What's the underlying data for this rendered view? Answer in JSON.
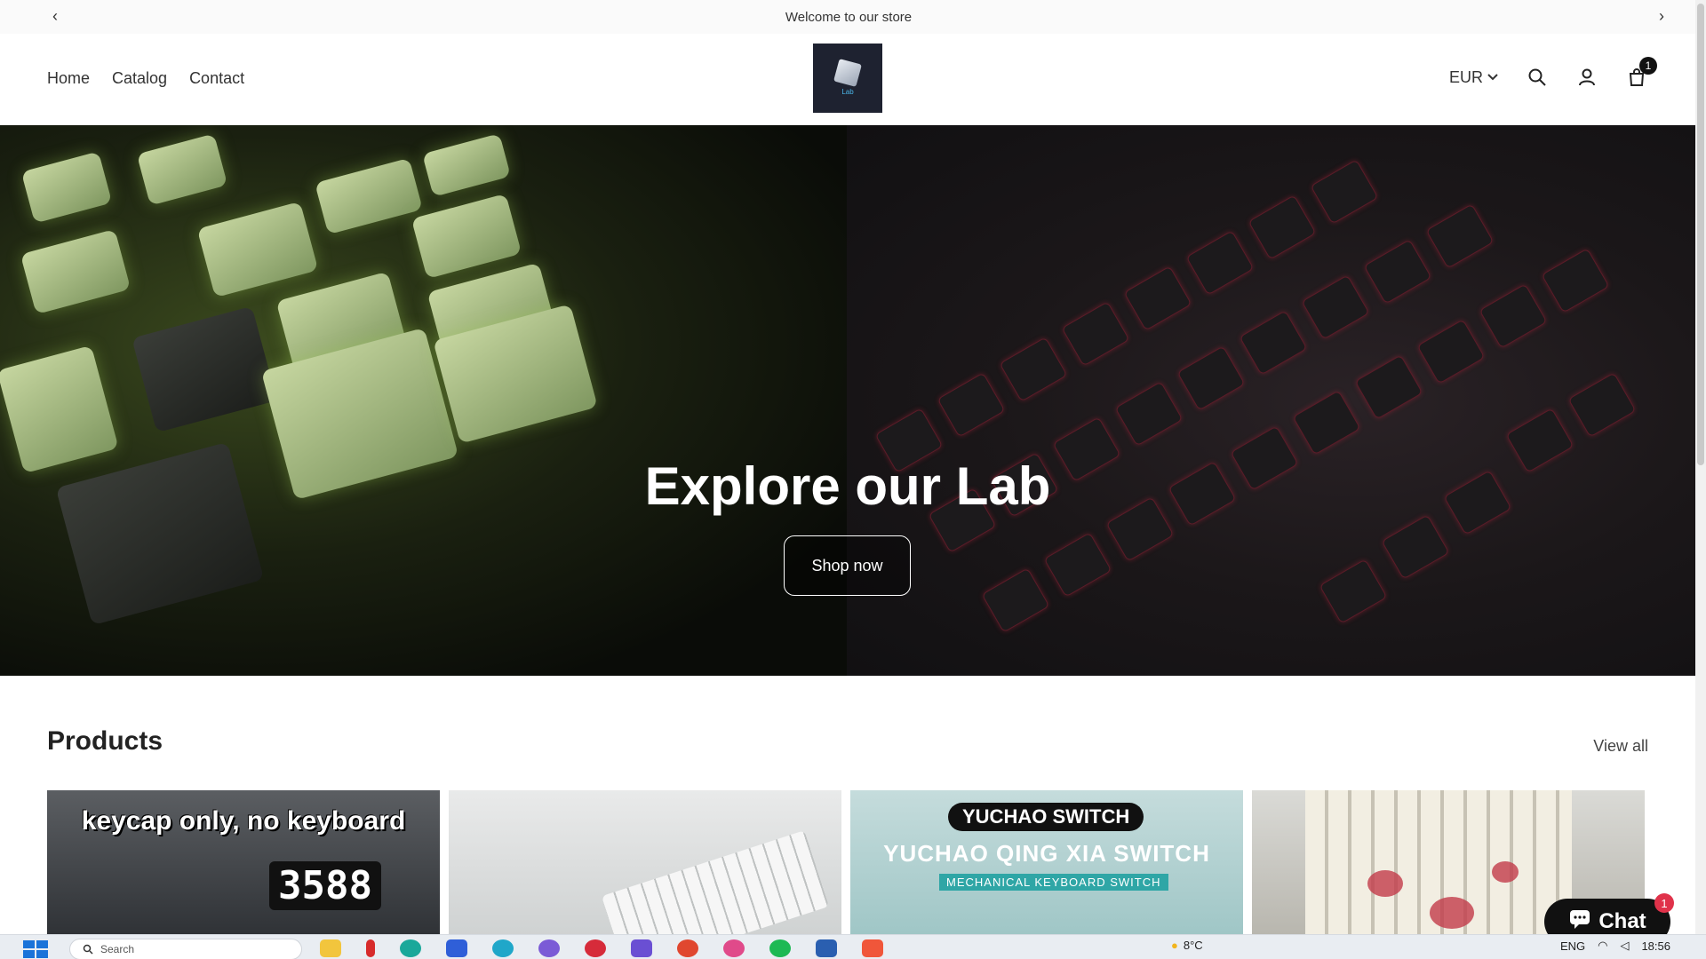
{
  "announcement": {
    "text": "Welcome to our store",
    "prev_icon": "‹",
    "next_icon": "›"
  },
  "header": {
    "nav": [
      "Home",
      "Catalog",
      "Contact"
    ],
    "logo_text": "Lab",
    "currency": "EUR",
    "currency_icon": "⌄",
    "cart_count": "1"
  },
  "hero": {
    "title": "Explore our Lab",
    "button": "Shop now"
  },
  "products": {
    "title": "Products",
    "view_all": "View all",
    "cards": [
      {
        "caption": "keycap only, no keyboard",
        "clock": "3588"
      },
      {},
      {
        "brand": "YUCHAO SWITCH",
        "subtitle": "YUCHAO QING XIA SWITCH",
        "tag": "MECHANICAL KEYBOARD SWITCH"
      },
      {}
    ]
  },
  "chat": {
    "label": "Chat",
    "badge": "1"
  },
  "taskbar": {
    "search_placeholder": "Search",
    "temperature": "8°C",
    "language": "ENG",
    "time": "18:56"
  }
}
